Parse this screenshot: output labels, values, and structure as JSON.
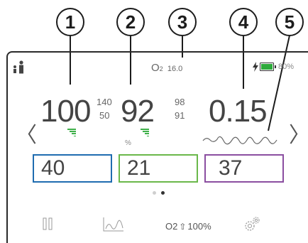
{
  "callouts": [
    "1",
    "2",
    "3",
    "4",
    "5"
  ],
  "status": {
    "oxygen_prefix": "O",
    "oxygen_sub": "2",
    "oxygen_value": "16.0",
    "battery_label": "80%",
    "patient_icon": "adult-child-icon",
    "charging_icon": "lightning-icon"
  },
  "readings": {
    "spo2": "100",
    "spo2_upper": "140",
    "spo2_lower": "50",
    "pulse": "92",
    "pulse_unit": "%",
    "pulse_upper": "98",
    "pulse_lower": "91",
    "pi": "0.15"
  },
  "boxes": [
    {
      "value": "40",
      "color": "#1f6cb0"
    },
    {
      "value": "21",
      "color": "#6ab84a"
    },
    {
      "value": "37",
      "color": "#8b4ea0"
    }
  ],
  "pager": {
    "active_index": 1,
    "count": 2
  },
  "navigation": {
    "prev_icon": "chevron-left-icon",
    "next_icon": "chevron-right-icon"
  },
  "toolbar": {
    "pause_icon": "pause-icon",
    "trend_icon": "trend-chart-icon",
    "o2_label": "O2",
    "o2_arrow_icon": "arrow-up-icon",
    "o2_value": "100%",
    "settings_icon": "settings-gears-icon"
  },
  "colors": {
    "bar_green": "#3fb04a",
    "battery_green": "#2eaa3b"
  }
}
